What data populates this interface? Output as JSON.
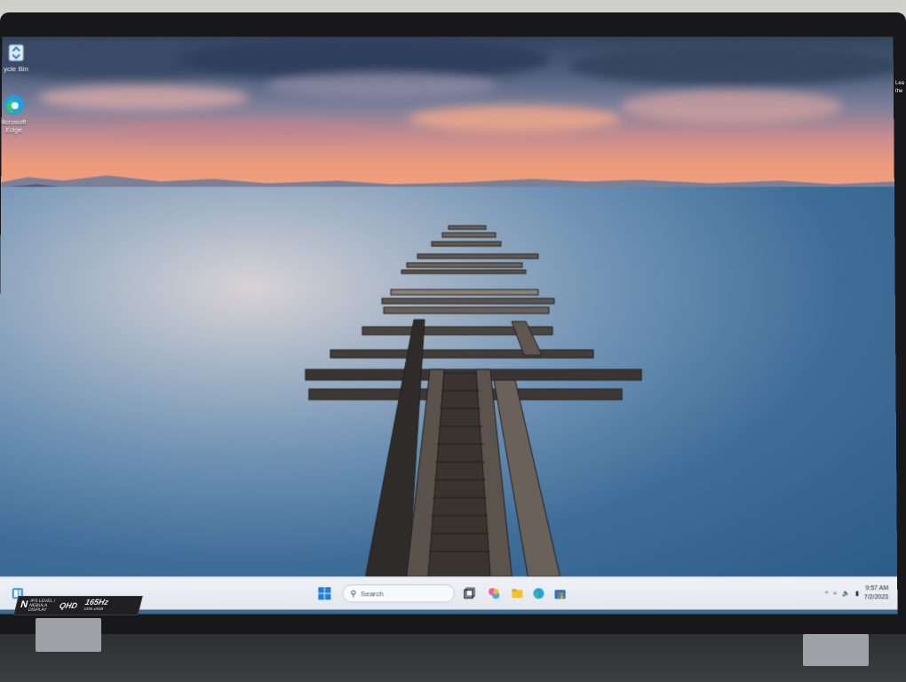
{
  "desktop": {
    "icons": [
      {
        "label_line1": "ycle Bin",
        "label_line2": "",
        "icon": "recycle-bin-icon"
      },
      {
        "label_line1": "licrosoft",
        "label_line2": "Edge",
        "icon": "edge-icon"
      }
    ],
    "right_edge_text": [
      "Lea",
      "the"
    ]
  },
  "taskbar": {
    "search_placeholder": "Search",
    "pinned": [
      "widgets-icon",
      "start-icon",
      "task-view-icon",
      "copilot-icon",
      "file-explorer-icon",
      "edge-icon",
      "store-icon"
    ],
    "tray": {
      "chevron": "^",
      "time": "9:57 AM",
      "date": "7/2/2023"
    }
  },
  "bezel_sticker": {
    "brand": "N",
    "panel_text": "IPS LEVEL / NEBULA DISPLAY",
    "resolution": "QHD",
    "refresh": "165Hz",
    "refresh_sub": "100% sRGB"
  },
  "colors": {
    "taskbar_bg": "#e8ebf1",
    "sea_deep": "#2a5a86",
    "sunset_orange": "#f1a07d"
  }
}
